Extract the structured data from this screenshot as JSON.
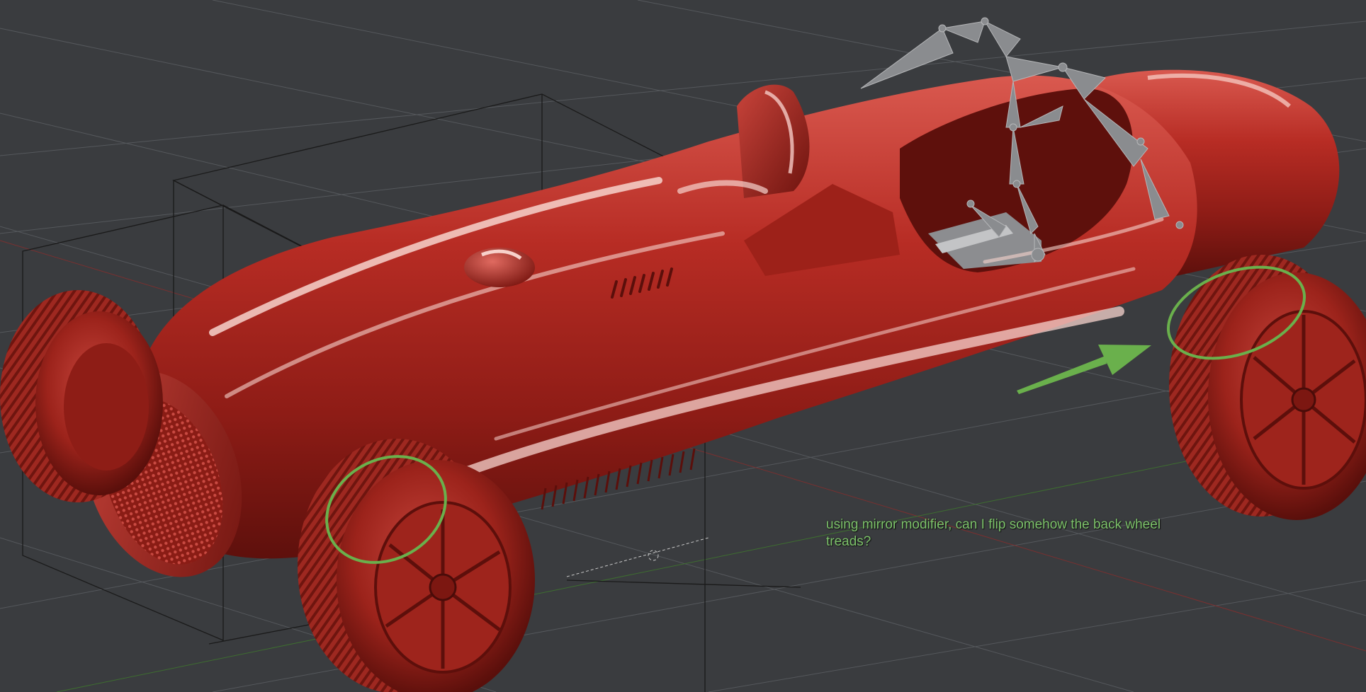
{
  "viewport": {
    "background_color": "#3a3c3f",
    "grid_color": "#55585c",
    "model_color": "#b02a22",
    "model_highlight": "#f2b8b0",
    "armature_color": "#8a8c8f",
    "annotation_color": "#6ab04c"
  },
  "annotation": {
    "text": "using mirror modifier, can I flip somehow the back wheel treads?"
  },
  "icons": {
    "arrow": "arrow-icon",
    "circle_front": "highlight-circle-icon",
    "circle_back": "highlight-circle-icon"
  }
}
